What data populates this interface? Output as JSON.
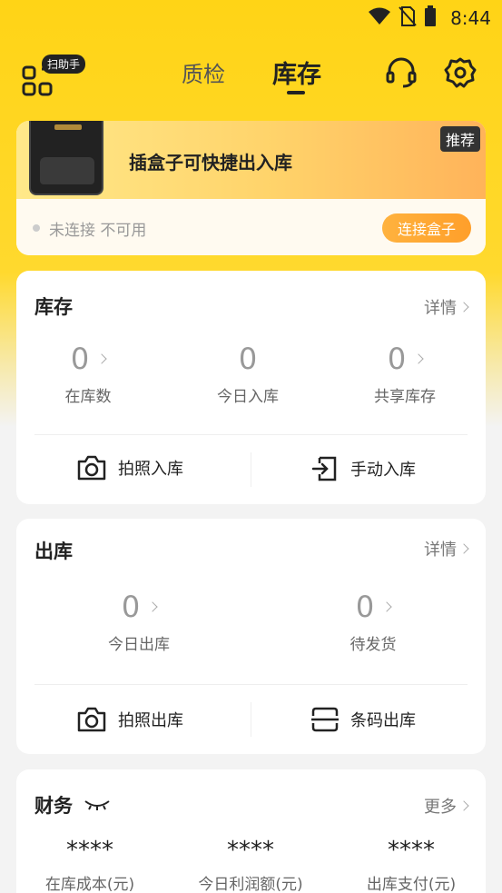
{
  "status_bar": {
    "time": "8:44"
  },
  "header": {
    "scan_badge": "扫助手",
    "tab_qc": "质检",
    "tab_inventory": "库存"
  },
  "promo": {
    "title": "插盒子可快捷出入库",
    "tag": "推荐",
    "status": "未连接 不可用",
    "connect_label": "连接盒子"
  },
  "inventory": {
    "title": "库存",
    "detail": "详情",
    "stats": [
      {
        "value": "0",
        "label": "在库数"
      },
      {
        "value": "0",
        "label": "今日入库"
      },
      {
        "value": "0",
        "label": "共享库存"
      }
    ],
    "actions": [
      "拍照入库",
      "手动入库"
    ]
  },
  "outbound": {
    "title": "出库",
    "detail": "详情",
    "stats": [
      {
        "value": "0",
        "label": "今日出库"
      },
      {
        "value": "0",
        "label": "待发货"
      }
    ],
    "actions": [
      "拍照出库",
      "条码出库"
    ]
  },
  "finance": {
    "title": "财务",
    "more": "更多",
    "stats": [
      {
        "value": "****",
        "label": "在库成本(元)"
      },
      {
        "value": "****",
        "label": "今日利润额(元)"
      },
      {
        "value": "****",
        "label": "出库支付(元)"
      }
    ]
  },
  "colors": {
    "accent": "#ffd416",
    "connect": "#ff9f2a"
  }
}
